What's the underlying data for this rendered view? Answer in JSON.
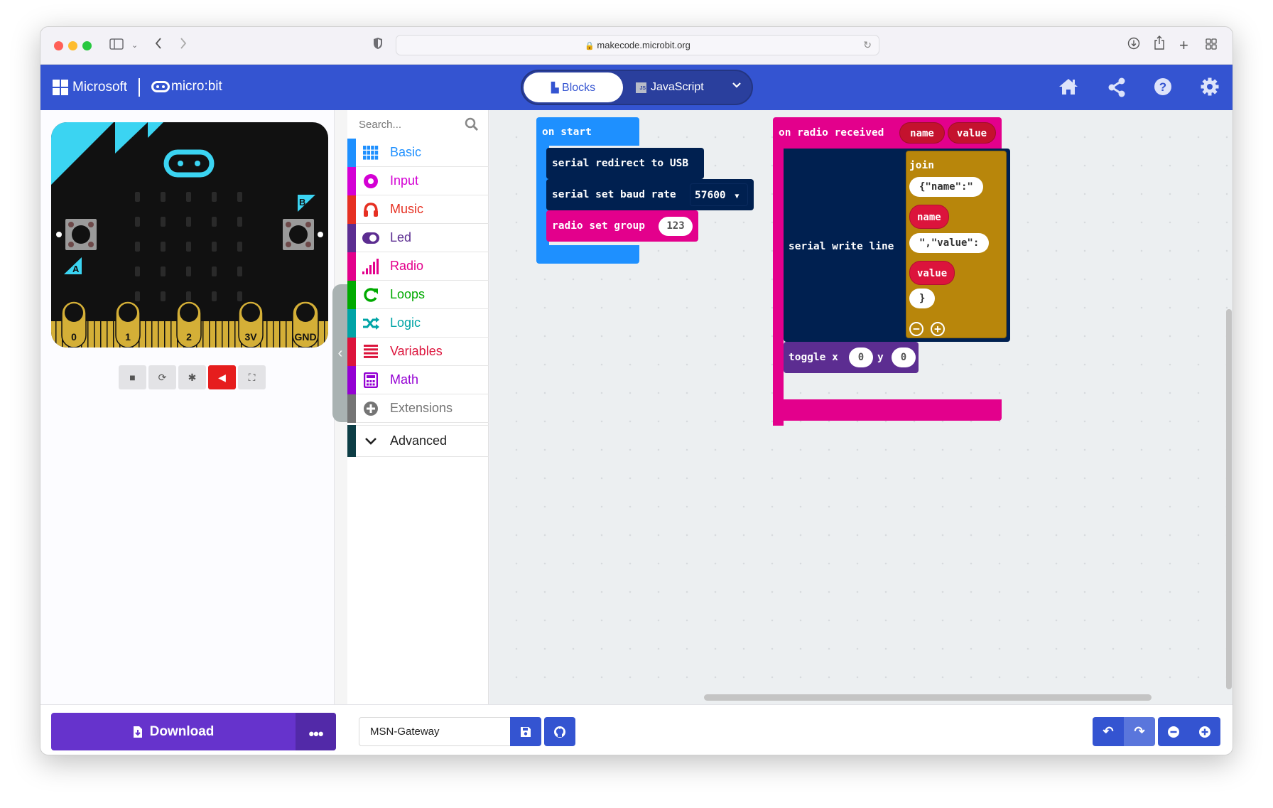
{
  "browser": {
    "url": "makecode.microbit.org",
    "traffic_lights": [
      "#ff5f57",
      "#febc2e",
      "#28c840"
    ]
  },
  "header": {
    "microsoft_label": "Microsoft",
    "microbit_label": "micro:bit",
    "tabs": [
      {
        "label": "Blocks",
        "active": true
      },
      {
        "label": "JavaScript",
        "active": false
      }
    ],
    "js_badge": "JS",
    "icons": [
      "home-icon",
      "share-icon",
      "help-icon",
      "settings-icon"
    ],
    "color": "#3454d1"
  },
  "simulator": {
    "pins": [
      "0",
      "1",
      "2",
      "3V",
      "GND"
    ],
    "button_a": "A",
    "button_b": "B",
    "controls": [
      "stop",
      "restart",
      "debug",
      "mute",
      "fullscreen"
    ]
  },
  "toolbox": {
    "search_placeholder": "Search...",
    "categories": [
      {
        "label": "Basic",
        "color": "#1e90ff",
        "icon": "grid-icon"
      },
      {
        "label": "Input",
        "color": "#d400d4",
        "icon": "target-icon"
      },
      {
        "label": "Music",
        "color": "#e63022",
        "icon": "headphones-icon"
      },
      {
        "label": "Led",
        "color": "#5c2d91",
        "icon": "toggle-icon"
      },
      {
        "label": "Radio",
        "color": "#e3008c",
        "icon": "signal-icon"
      },
      {
        "label": "Loops",
        "color": "#00aa00",
        "icon": "refresh-icon"
      },
      {
        "label": "Logic",
        "color": "#00a4a6",
        "icon": "shuffle-icon"
      },
      {
        "label": "Variables",
        "color": "#dc143c",
        "icon": "list-icon"
      },
      {
        "label": "Math",
        "color": "#9400d3",
        "icon": "calculator-icon"
      },
      {
        "label": "Extensions",
        "color": "#757575",
        "icon": "plus-circle-icon"
      }
    ],
    "advanced_label": "Advanced"
  },
  "workspace": {
    "on_start": {
      "label": "on start",
      "blocks": [
        {
          "text": "serial redirect to USB"
        },
        {
          "text": "serial set baud rate",
          "value": "57600"
        },
        {
          "text": "radio set group",
          "value": "123"
        }
      ]
    },
    "on_radio_received": {
      "label": "on radio received",
      "params": [
        "name",
        "value"
      ],
      "serial_write_line": "serial write line",
      "join_label": "join",
      "join_items": [
        {
          "type": "string",
          "value": "{\"name\":\""
        },
        {
          "type": "var",
          "value": "name"
        },
        {
          "type": "string",
          "value": "\",\"value\":"
        },
        {
          "type": "var",
          "value": "value"
        },
        {
          "type": "string",
          "value": "}"
        }
      ],
      "toggle": {
        "label": "toggle x",
        "x": "0",
        "y_label": "y",
        "y": "0"
      }
    }
  },
  "footer": {
    "download_label": "Download",
    "more_label": "•••",
    "project_name": "MSN-Gateway"
  }
}
